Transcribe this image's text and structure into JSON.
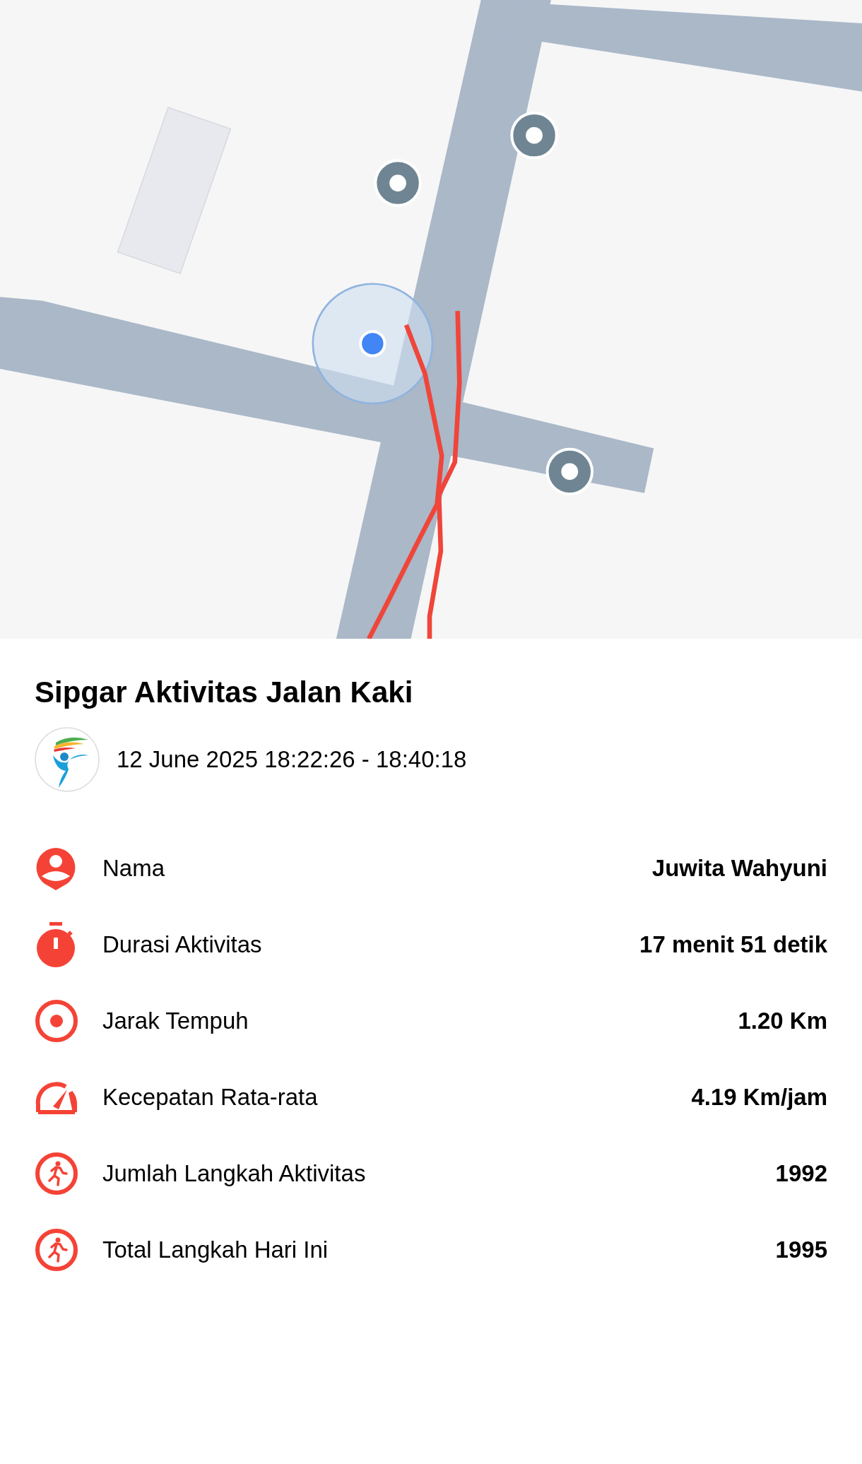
{
  "title": "Sipgar Aktivitas Jalan Kaki",
  "time_range": "12 June 2025 18:22:26 - 18:40:18",
  "stats": [
    {
      "label": "Nama",
      "value": "Juwita Wahyuni"
    },
    {
      "label": "Durasi Aktivitas",
      "value": "17 menit 51 detik"
    },
    {
      "label": "Jarak Tempuh",
      "value": "1.20 Km"
    },
    {
      "label": "Kecepatan Rata-rata",
      "value": "4.19 Km/jam"
    },
    {
      "label": "Jumlah Langkah Aktivitas",
      "value": "1992"
    },
    {
      "label": "Total Langkah Hari Ini",
      "value": "1995"
    }
  ]
}
